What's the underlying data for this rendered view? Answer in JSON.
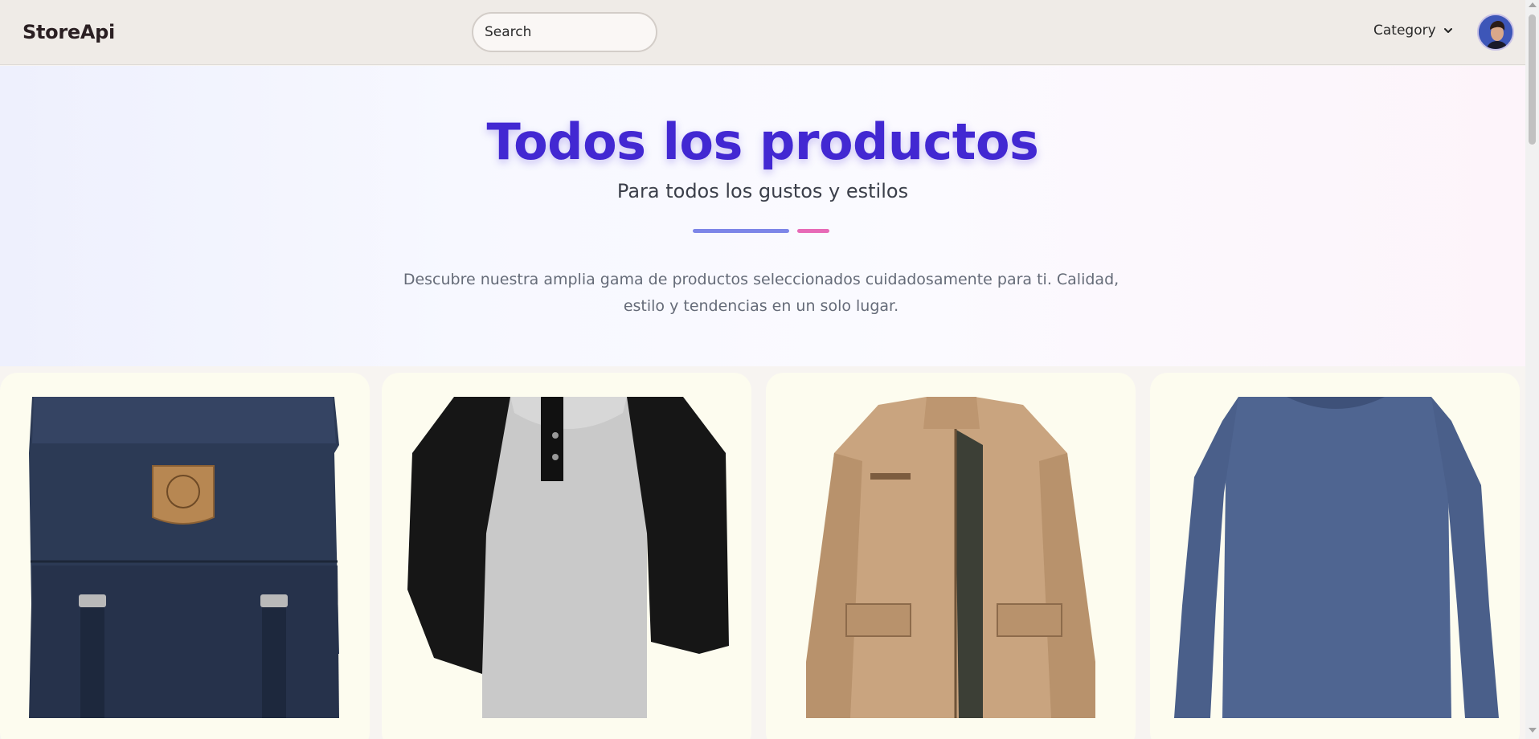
{
  "navbar": {
    "brand": "StoreApi",
    "search_placeholder": "Search",
    "category_label": "Category"
  },
  "hero": {
    "title": "Todos los productos",
    "subtitle": "Para todos los gustos y estilos",
    "description": "Descubre nuestra amplia gama de productos seleccionados cuidadosamente para ti. Calidad, estilo y tendencias en un solo lugar.",
    "colors": {
      "title": "#4228d2",
      "accent_bar_1": "#7d86e8",
      "accent_bar_2": "#e76ab7"
    }
  },
  "products": [
    {
      "image": "navy-backpack"
    },
    {
      "image": "raglan-henley-shirt"
    },
    {
      "image": "khaki-jacket"
    },
    {
      "image": "blue-long-sleeve-tshirt"
    }
  ]
}
